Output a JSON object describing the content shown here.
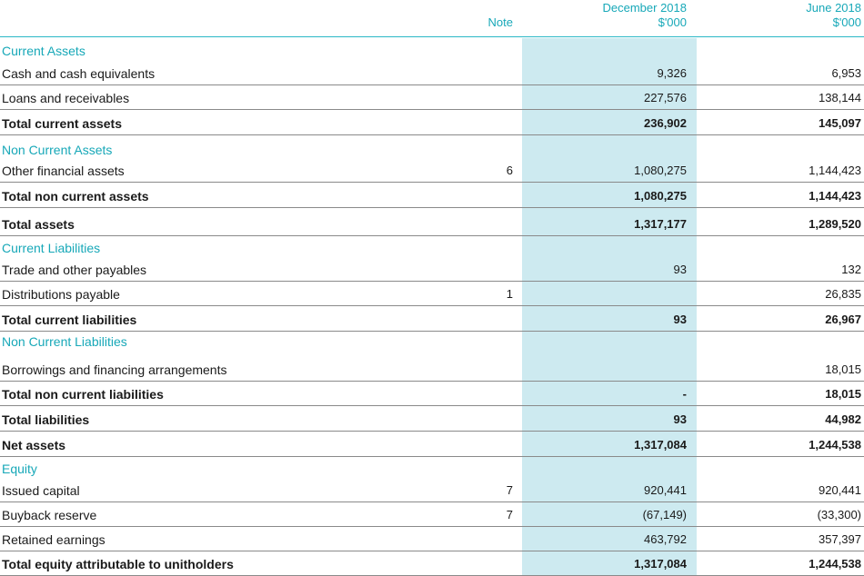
{
  "header": {
    "note": "Note",
    "col1_line1": "December 2018",
    "col1_line2": "$'000",
    "col2_line1": "June 2018",
    "col2_line2": "$'000"
  },
  "rows": [
    {
      "label": "Current Assets",
      "type": "section"
    },
    {
      "label": "Cash and cash equivalents",
      "note": "",
      "dec": "9,326",
      "jun": "6,953"
    },
    {
      "label": "Loans and receivables",
      "note": "",
      "dec": "227,576",
      "jun": "138,144"
    },
    {
      "label": "Total current assets",
      "note": "",
      "dec": "236,902",
      "jun": "145,097"
    },
    {
      "label": "Non Current Assets",
      "type": "section"
    },
    {
      "label": "Other financial assets",
      "note": "6",
      "dec": "1,080,275",
      "jun": "1,144,423"
    },
    {
      "label": "Total non current assets",
      "note": "",
      "dec": "1,080,275",
      "jun": "1,144,423"
    },
    {
      "label": "Total assets",
      "note": "",
      "dec": "1,317,177",
      "jun": "1,289,520"
    },
    {
      "label": "Current Liabilities",
      "type": "section"
    },
    {
      "label": "Trade and other payables",
      "note": "",
      "dec": "93",
      "jun": "132"
    },
    {
      "label": "Distributions payable",
      "note": "1",
      "dec": "",
      "jun": "26,835"
    },
    {
      "label": "Total current liabilities",
      "note": "",
      "dec": "93",
      "jun": "26,967"
    },
    {
      "label": "Non Current Liabilities",
      "type": "section"
    },
    {
      "label": "Borrowings and financing arrangements",
      "note": "",
      "dec": "",
      "jun": "18,015"
    },
    {
      "label": "Total non current liabilities",
      "note": "",
      "dec": "-",
      "jun": "18,015"
    },
    {
      "label": "Total liabilities",
      "note": "",
      "dec": "93",
      "jun": "44,982"
    },
    {
      "label": "Net assets",
      "note": "",
      "dec": "1,317,084",
      "jun": "1,244,538"
    },
    {
      "label": "Equity",
      "type": "section"
    },
    {
      "label": "Issued capital",
      "note": "7",
      "dec": "920,441",
      "jun": "920,441"
    },
    {
      "label": "Buyback reserve",
      "note": "7",
      "dec": "(67,149)",
      "jun": "(33,300)"
    },
    {
      "label": "Retained earnings",
      "note": "",
      "dec": "463,792",
      "jun": "357,397"
    },
    {
      "label": "Total equity attributable to unitholders",
      "note": "",
      "dec": "1,317,084",
      "jun": "1,244,538"
    }
  ],
  "colors": {
    "accent": "#17a8b8",
    "highlight": "#cdeaf0",
    "rule": "#8a8a8a"
  }
}
